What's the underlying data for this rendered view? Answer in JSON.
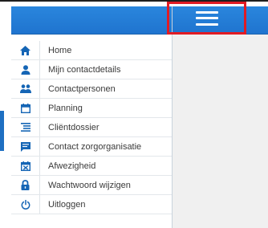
{
  "colors": {
    "header_blue": "#1f74cf",
    "icon_blue": "#1565b5",
    "highlight_red": "#e01b24",
    "content_bg": "#f0f0f0"
  },
  "header": {
    "menu_toggle_icon": "hamburger-icon"
  },
  "sidebar": {
    "items": [
      {
        "label": "Home",
        "icon": "home-icon"
      },
      {
        "label": "Mijn contactdetails",
        "icon": "person-icon"
      },
      {
        "label": "Contactpersonen",
        "icon": "people-icon"
      },
      {
        "label": "Planning",
        "icon": "calendar-icon"
      },
      {
        "label": "Cliëntdossier",
        "icon": "list-icon"
      },
      {
        "label": "Contact zorgorganisatie",
        "icon": "message-icon"
      },
      {
        "label": "Afwezigheid",
        "icon": "calendar-cross-icon"
      },
      {
        "label": "Wachtwoord wijzigen",
        "icon": "lock-icon"
      },
      {
        "label": "Uitloggen",
        "icon": "power-icon"
      }
    ]
  }
}
